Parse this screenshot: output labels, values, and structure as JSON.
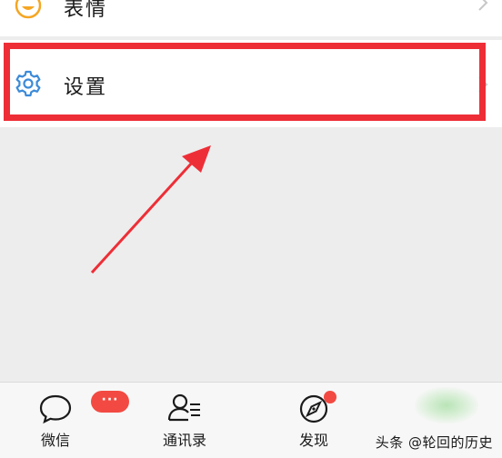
{
  "list": {
    "items": [
      {
        "label": "表情",
        "icon": "emoji-icon",
        "icon_color": "#f5a623"
      },
      {
        "label": "设置",
        "icon": "gear-icon",
        "icon_color": "#3d8bd8"
      }
    ]
  },
  "annotation": {
    "highlight_color": "#ee2e37"
  },
  "tabbar": {
    "tabs": [
      {
        "label": "微信",
        "icon": "chat-bubble-icon",
        "badge": "···"
      },
      {
        "label": "通讯录",
        "icon": "contacts-icon"
      },
      {
        "label": "发现",
        "icon": "compass-icon"
      }
    ],
    "badge_color": "#f24a42"
  },
  "watermark": "头条 @轮回的历史"
}
